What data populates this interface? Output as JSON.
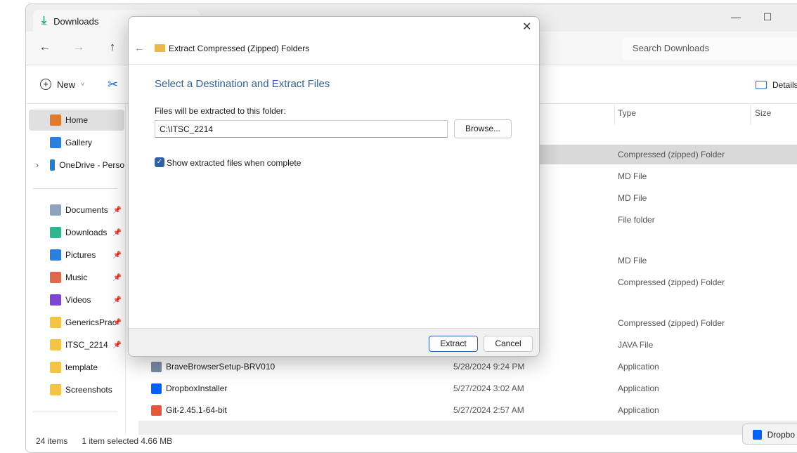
{
  "window": {
    "tab_title": "Downloads",
    "search_placeholder": "Search Downloads"
  },
  "toolbar": {
    "new_label": "New",
    "details_label": "Details"
  },
  "columns": {
    "type": "Type",
    "size": "Size"
  },
  "sidebar": {
    "items": [
      {
        "label": "Home",
        "icon": "home-icon",
        "color": "#e07a2f"
      },
      {
        "label": "Gallery",
        "icon": "gallery-icon",
        "color": "#2b7de0"
      },
      {
        "label": "OneDrive - Perso",
        "icon": "cloud-icon",
        "color": "#1d7fd8"
      },
      {
        "label": "Documents",
        "icon": "documents-icon",
        "color": "#8fa3bf"
      },
      {
        "label": "Downloads",
        "icon": "download-icon",
        "color": "#2fb58f"
      },
      {
        "label": "Pictures",
        "icon": "pictures-icon",
        "color": "#2b7de0"
      },
      {
        "label": "Music",
        "icon": "music-icon",
        "color": "#e0684f"
      },
      {
        "label": "Videos",
        "icon": "videos-icon",
        "color": "#7b45d6"
      },
      {
        "label": "GenericsPrac",
        "icon": "folder-icon",
        "color": "#f5c542"
      },
      {
        "label": "ITSC_2214",
        "icon": "folder-icon",
        "color": "#f5c542"
      },
      {
        "label": "template",
        "icon": "folder-icon",
        "color": "#f5c542"
      },
      {
        "label": "Screenshots",
        "icon": "folder-icon",
        "color": "#f5c542"
      }
    ]
  },
  "files": [
    {
      "name": "",
      "date": "",
      "type": "Compressed (zipped) Folder",
      "selected": true
    },
    {
      "name": "",
      "date": "",
      "type": "MD File"
    },
    {
      "name": "",
      "date": "",
      "type": "MD File"
    },
    {
      "name": "",
      "date": "",
      "type": "File folder"
    },
    {
      "name": "",
      "date": "",
      "type": "MD File"
    },
    {
      "name": "",
      "date": "",
      "type": "Compressed (zipped) Folder"
    },
    {
      "name": "",
      "date": "",
      "type": "Compressed (zipped) Folder"
    },
    {
      "name": "",
      "date": "",
      "type": "JAVA File"
    },
    {
      "name": "BraveBrowserSetup-BRV010",
      "date": "5/28/2024 9:24 PM",
      "type": "Application"
    },
    {
      "name": "DropboxInstaller",
      "date": "5/27/2024 3:02 AM",
      "type": "Application"
    },
    {
      "name": "Git-2.45.1-64-bit",
      "date": "5/27/2024 2:57 AM",
      "type": "Application"
    }
  ],
  "status": {
    "count": "24 items",
    "selected": "1 item selected  4.66 MB"
  },
  "notification": {
    "label": "Dropbo"
  },
  "dialog": {
    "title": "Extract Compressed (Zipped) Folders",
    "heading": "Select a Destination and Extract Files",
    "folder_label": "Files will be extracted to this folder:",
    "folder_value": "C:\\ITSC_2214",
    "browse": "Browse...",
    "checkbox_label": "Show extracted files when complete",
    "checkbox_checked": true,
    "extract": "Extract",
    "cancel": "Cancel",
    "accent": "#2e5fa8"
  }
}
